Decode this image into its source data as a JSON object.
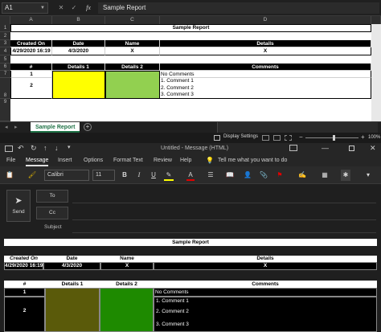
{
  "excel": {
    "name_box": "A1",
    "formula_value": "Sample Report",
    "columns": [
      "A",
      "B",
      "C",
      "D"
    ],
    "rows": [
      "1",
      "2",
      "3",
      "4",
      "5",
      "6",
      "7",
      "8",
      "9"
    ],
    "report_title": "Sample Report",
    "headers": [
      "Created On",
      "Date",
      "Name",
      "Details"
    ],
    "values": [
      "4/29/2020 16:19",
      "4/3/2020",
      "X",
      "X"
    ],
    "table2_headers": [
      "#",
      "Details 1",
      "Details 2",
      "Comments"
    ],
    "row1_num": "1",
    "row1_comment": "No Comments",
    "row2_num": "2",
    "row2_comments": [
      "1. Comment 1",
      "2. Comment 2",
      "3. Comment 3"
    ],
    "sheet_tab": "Sample Report",
    "display_settings": "Display Settings",
    "zoom": "100%",
    "colors": {
      "yellow": "#ffff00",
      "green": "#92d050"
    }
  },
  "outlook": {
    "window_title": "Untitled  -  Message (HTML)",
    "tabs": [
      "File",
      "Message",
      "Insert",
      "Options",
      "Format Text",
      "Review",
      "Help"
    ],
    "tell_me": "Tell me what you want to do",
    "font": "Calibri",
    "font_size": "11",
    "send_label": "Send",
    "to_label": "To",
    "cc_label": "Cc",
    "subject_label": "Subject",
    "body": {
      "report_title": "Sample Report",
      "headers": [
        "Created On",
        "Date",
        "Name",
        "Details"
      ],
      "values": [
        "4/29/2020 16:19",
        "4/3/2020",
        "X",
        "X"
      ],
      "table2_headers": [
        "#",
        "Details 1",
        "Details 2",
        "Comments"
      ],
      "row1_num": "1",
      "row1_comment": "No Comments",
      "row2_num": "2",
      "row2_comments": [
        "1. Comment 1",
        "2. Comment 2",
        "3. Comment 3"
      ],
      "colors": {
        "olive": "#5a5a0a",
        "green": "#1e8a00"
      }
    }
  }
}
